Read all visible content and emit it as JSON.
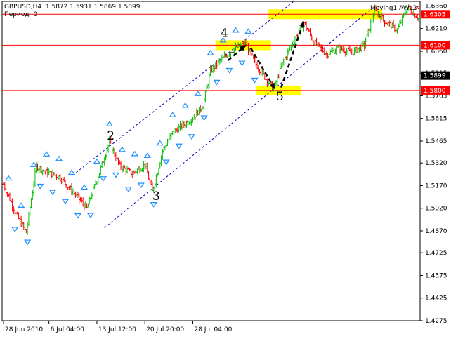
{
  "window": {
    "symbol_line": "GBPUSD,H4  1.5872 1.5931 1.5869 1.5899",
    "period_line": "Период  0",
    "indicator_label": "Moving1 AWL2"
  },
  "chart_data": {
    "type": "candlestick",
    "y_ticks": [
      "1.6360",
      "1.6210",
      "1.6060",
      "1.5915",
      "1.5765",
      "1.5615",
      "1.5465",
      "1.5320",
      "1.5170",
      "1.5020",
      "1.4870",
      "1.4725",
      "1.4575",
      "1.4425",
      "1.4275"
    ],
    "ylim": [
      1.4275,
      1.639
    ],
    "x_ticks": [
      {
        "label": "28 Jun 2010",
        "i": 0
      },
      {
        "label": "6 Jul 04:00",
        "i": 36
      },
      {
        "label": "13 Jul 12:00",
        "i": 74
      },
      {
        "label": "20 Jul 20:00",
        "i": 112
      },
      {
        "label": "28 Jul 04:00",
        "i": 150
      }
    ],
    "bars_count": 330,
    "horizontal_levels": [
      {
        "value": 1.6305,
        "label": "1.6305",
        "color": "#ff0000"
      },
      {
        "value": 1.61,
        "label": "1.6100",
        "color": "#ff0000"
      },
      {
        "value": 1.58,
        "label": "1.5800",
        "color": "#ff0000"
      }
    ],
    "current_price": {
      "value": 1.5899,
      "label": "1.5899"
    },
    "wave_labels": [
      {
        "text": "2",
        "i": 82,
        "price": 1.5475
      },
      {
        "text": "3",
        "i": 118,
        "price": 1.5075
      },
      {
        "text": "4",
        "i": 172,
        "price": 1.6155
      },
      {
        "text": "5",
        "i": 216,
        "price": 1.5735
      }
    ],
    "highlight_zones": [
      {
        "i0": 168,
        "i1": 212,
        "price": 1.61,
        "color": "#ffff00"
      },
      {
        "i0": 200,
        "i1": 236,
        "price": 1.58,
        "color": "#ffff00"
      },
      {
        "i0": 210,
        "i1": 300,
        "price": 1.6305,
        "color": "#ffff00"
      }
    ],
    "arrows": [
      {
        "from": {
          "i": 178,
          "price": 1.6
        },
        "to": {
          "i": 192,
          "price": 1.61
        }
      },
      {
        "from": {
          "i": 196,
          "price": 1.608
        },
        "to": {
          "i": 215,
          "price": 1.581
        }
      },
      {
        "from": {
          "i": 220,
          "price": 1.582
        },
        "to": {
          "i": 238,
          "price": 1.626
        }
      }
    ],
    "channel_lines": [
      {
        "from": {
          "i": 55,
          "price": 1.524
        },
        "to": {
          "i": 230,
          "price": 1.639
        }
      },
      {
        "from": {
          "i": 80,
          "price": 1.489
        },
        "to": {
          "i": 290,
          "price": 1.633
        }
      }
    ],
    "colors": {
      "bull": "#00c000",
      "bear": "#ff0000",
      "fractal": "#1e90ff",
      "level": "#ff0000",
      "channel": "#0000c0"
    }
  }
}
